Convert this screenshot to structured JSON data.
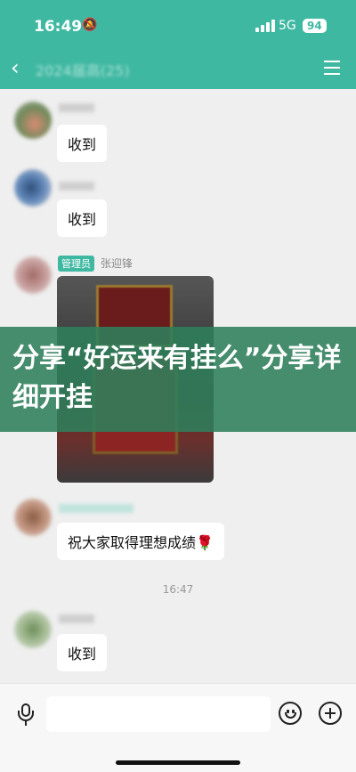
{
  "status_bar": {
    "time": "16:49",
    "network": "5G",
    "battery": "94"
  },
  "nav": {
    "title": "2024届高(25)"
  },
  "messages": {
    "m1": {
      "text": "收到"
    },
    "m2": {
      "text": "收到"
    },
    "m3": {
      "badge": "管理员",
      "sender": "张迎锋"
    },
    "m4": {
      "text": "祝大家取得理想成绩",
      "emoji": "🌹"
    },
    "time_separator": "16:47",
    "m5": {
      "text": "收到"
    }
  },
  "overlay": {
    "headline": "分享“好运来有挂么”分享详细开挂"
  },
  "colors": {
    "accent": "#3fb8a2",
    "overlay": "#2f805c"
  },
  "icons": [
    "back-icon",
    "menu-icon",
    "mute-icon",
    "mic-icon",
    "emoji-icon",
    "plus-icon"
  ]
}
